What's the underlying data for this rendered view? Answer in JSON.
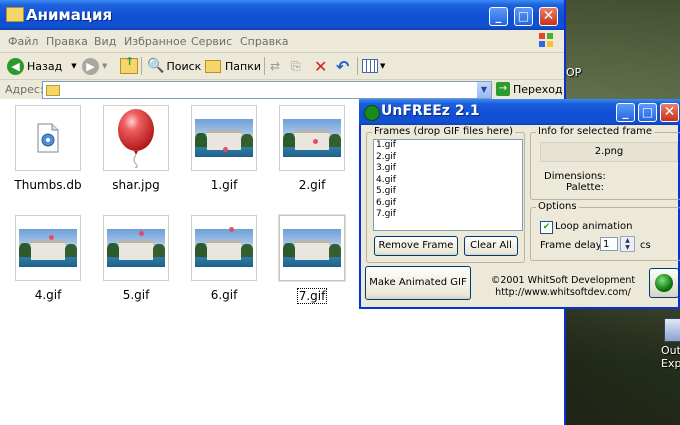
{
  "explorer": {
    "title": "Анимация",
    "menu": [
      "Файл",
      "Правка",
      "Вид",
      "Избранное",
      "Сервис",
      "Справка"
    ],
    "toolbar": {
      "back": "Назад",
      "search": "Поиск",
      "folders": "Папки"
    },
    "address_label": "Адрес:",
    "go_label": "Переход",
    "files": [
      {
        "name": "Thumbs.db",
        "type": "db-icon"
      },
      {
        "name": "shar.jpg",
        "type": "balloon"
      },
      {
        "name": "1.gif",
        "type": "photo"
      },
      {
        "name": "2.gif",
        "type": "photo"
      },
      {
        "name": "4.gif",
        "type": "photo"
      },
      {
        "name": "5.gif",
        "type": "photo"
      },
      {
        "name": "6.gif",
        "type": "photo"
      },
      {
        "name": "7.gif",
        "type": "photo",
        "selected": true
      }
    ]
  },
  "desktop": {
    "label_partial_1": "ОР",
    "label_partial_2": "Out",
    "label_partial_3": "Exp"
  },
  "unfreez": {
    "title": "UnFREEz 2.1",
    "frames_label": "Frames (drop GIF files here)",
    "frames": [
      "1.gif",
      "2.gif",
      "3.gif",
      "4.gif",
      "5.gif",
      "6.gif",
      "7.gif"
    ],
    "remove_button": "Remove Frame",
    "clear_button": "Clear All",
    "info_label": "Info for selected frame",
    "info_file": "2.png",
    "dimensions_label": "Dimensions:",
    "palette_label": "Palette:",
    "options_label": "Options",
    "loop_label": "Loop animation",
    "loop_checked": true,
    "delay_label": "Frame delay:",
    "delay_value": "1",
    "delay_unit": "cs",
    "make_button": "Make Animated GIF",
    "copyright": "©2001 WhitSoft Development",
    "url": "http://www.whitsoftdev.com/"
  }
}
